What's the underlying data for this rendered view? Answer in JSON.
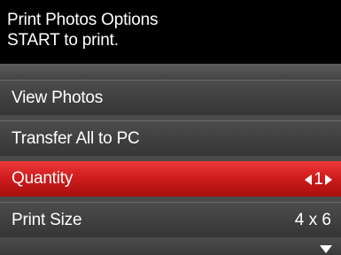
{
  "header": {
    "title": "Print Photos Options",
    "subtitle": "START to print."
  },
  "menu": {
    "items": [
      {
        "label": "View Photos"
      },
      {
        "label": "Transfer All to PC"
      },
      {
        "label": "Quantity",
        "value": "1",
        "selected": true
      },
      {
        "label": "Print Size",
        "value": "4 x 6"
      }
    ]
  },
  "icons": {
    "decrease": "triangle-left-icon",
    "increase": "triangle-right-icon",
    "scroll": "triangle-down-icon"
  },
  "colors": {
    "highlight": "#d11c1c",
    "header_bg": "#000000",
    "menu_bg": "#3c3c3c"
  }
}
